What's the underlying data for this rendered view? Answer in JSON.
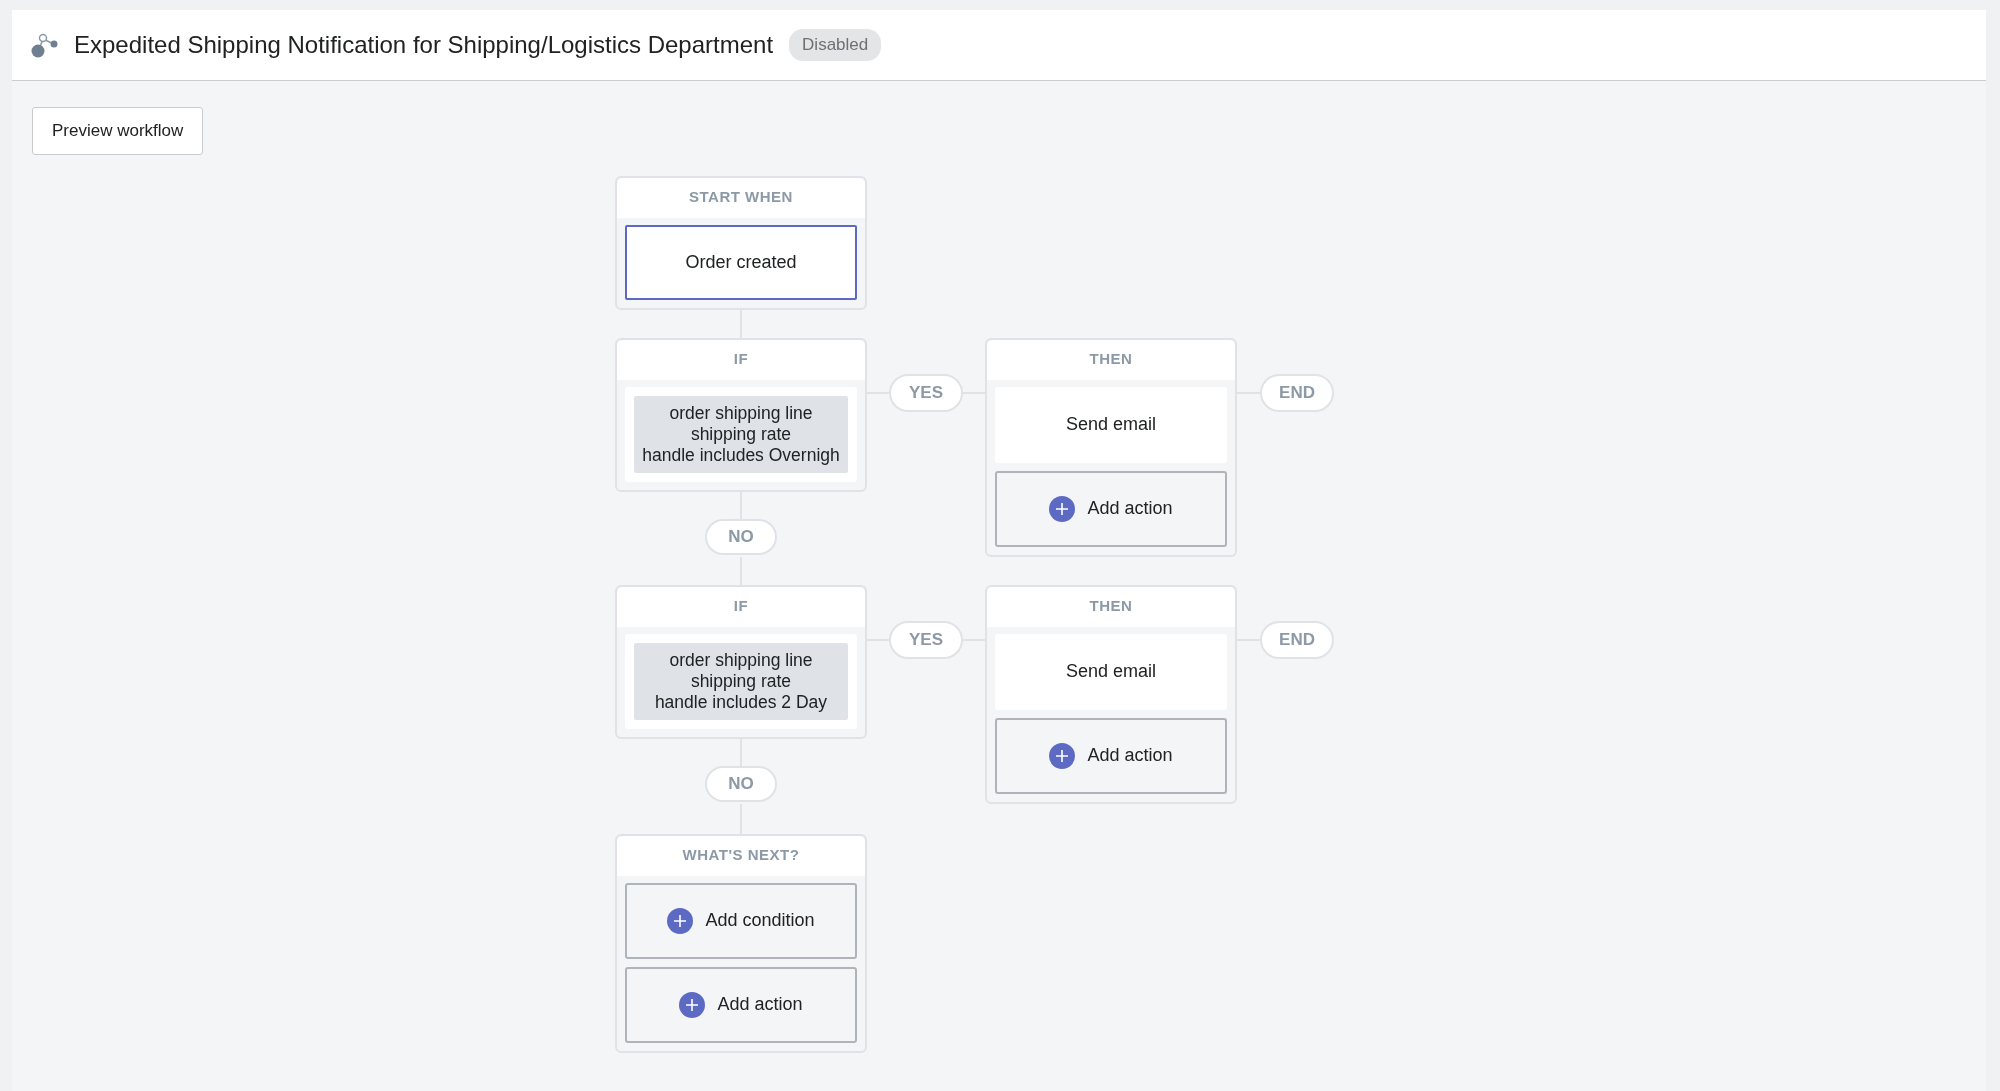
{
  "header": {
    "title": "Expedited Shipping Notification for Shipping/Logistics Department",
    "status": "Disabled"
  },
  "preview_button": "Preview workflow",
  "trigger": {
    "heading": "START WHEN",
    "label": "Order created",
    "selected": true
  },
  "branches": [
    {
      "heading": "IF",
      "condition_lines": [
        "order shipping line",
        "shipping rate",
        "handle includes Overnigh"
      ],
      "yes_label": "YES",
      "then": {
        "heading": "THEN",
        "actions": [
          "Send email"
        ],
        "add_action": "Add action"
      },
      "end_label": "END",
      "no_label": "NO"
    },
    {
      "heading": "IF",
      "condition_lines": [
        "order shipping line",
        "shipping rate",
        "handle includes 2 Day"
      ],
      "yes_label": "YES",
      "then": {
        "heading": "THEN",
        "actions": [
          "Send email"
        ],
        "add_action": "Add action"
      },
      "end_label": "END",
      "no_label": "NO"
    }
  ],
  "next": {
    "heading": "WHAT'S NEXT?",
    "buttons": [
      "Add condition",
      "Add action"
    ]
  }
}
